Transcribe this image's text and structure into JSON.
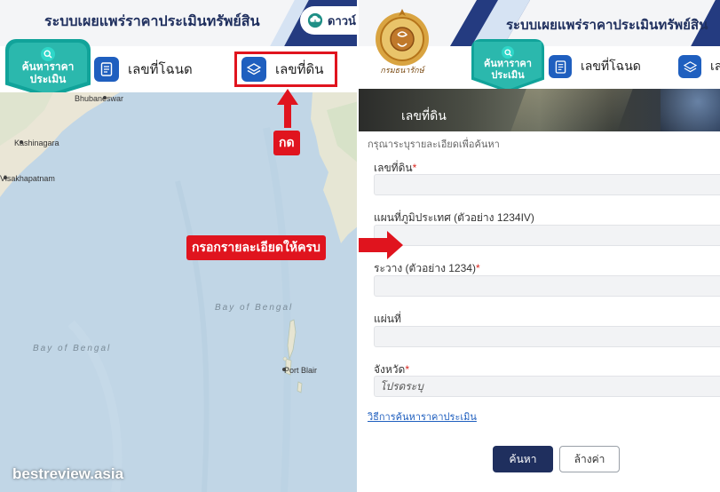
{
  "left": {
    "title": "ระบบเผยแพร่ราคาประเมินทรัพย์สิน",
    "download_label": "ดาวน์",
    "search_badge": "ค้นหาราคา\nประเมิน",
    "tabs": [
      {
        "label": "เลขที่โฉนด",
        "icon": "document-icon"
      },
      {
        "label": "เลขที่ดิน",
        "icon": "layers-icon"
      }
    ],
    "map_labels": {
      "bhubaneswar": "Bhubaneswar",
      "kashinagara": "Kashinagara",
      "visakhapatnam": "Visakhapatnam",
      "bay1": "Bay of Bengal",
      "bay2": "Bay of Bengal",
      "port_blair": "Port Blair"
    },
    "watermark": "bestreview.asia"
  },
  "annotations": {
    "press": "กด",
    "fill_in": "กรอกรายละเอียดให้ครบ"
  },
  "right": {
    "title": "ระบบเผยแพร่ราคาประเมินทรัพย์สิน",
    "seal_text": "กรมธนารักษ์",
    "search_badge": "ค้นหาราคา\nประเมิน",
    "tabs": [
      {
        "label": "เลขที่โฉนด",
        "icon": "document-icon"
      },
      {
        "label": "เลข",
        "icon": "layers-icon"
      }
    ],
    "banner_title": "เลขที่ดิน",
    "instruction": "กรุณาระบุรายละเอียดเพื่อค้นหา",
    "fields": [
      {
        "label": "เลขที่ดิน",
        "required": true,
        "value": ""
      },
      {
        "label": "แผนที่ภูมิประเทศ (ตัวอย่าง 1234IV)",
        "required": false,
        "value": ""
      },
      {
        "label": "ระวาง (ตัวอย่าง 1234)",
        "required": true,
        "value": ""
      },
      {
        "label": "แผ่นที่",
        "required": false,
        "value": ""
      },
      {
        "label": "จังหวัด",
        "required": true,
        "value": "โปรดระบุ"
      }
    ],
    "required_mark": "*",
    "help_link": "วิธีการค้นหาราคาประเมิน",
    "search_button": "ค้นหา",
    "clear_button": "ล้างค่า"
  },
  "colors": {
    "navy": "#1f2f5e",
    "teal": "#11a39a",
    "accent_blue": "#1f5fbf",
    "annotation_red": "#e0141e"
  }
}
